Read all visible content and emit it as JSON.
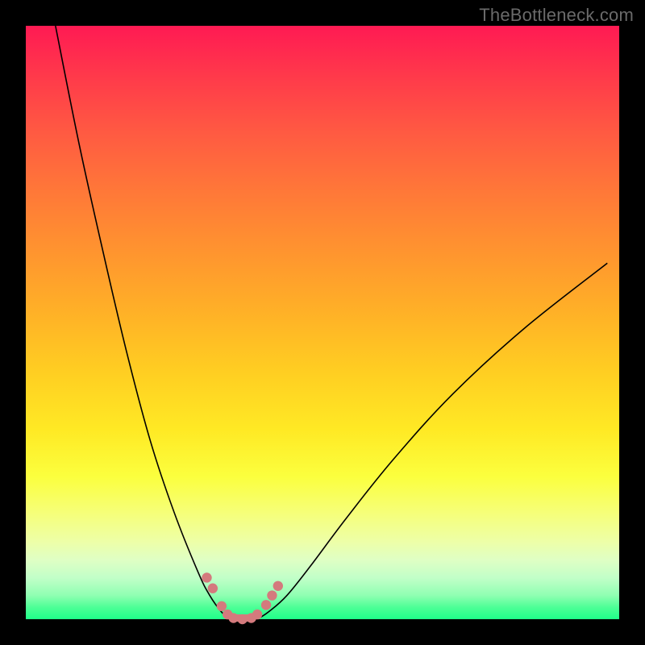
{
  "watermark": "TheBottleneck.com",
  "colors": {
    "frame": "#000000",
    "curve": "#000000",
    "beads": "#d47a7d"
  },
  "chart_data": {
    "type": "line",
    "title": "",
    "xlabel": "",
    "ylabel": "",
    "xlim": [
      0,
      100
    ],
    "ylim": [
      0,
      100
    ],
    "grid": false,
    "legend": false,
    "series": [
      {
        "name": "left-curve",
        "x": [
          5,
          9,
          13,
          17,
          21,
          25,
          29,
          31,
          33,
          34.5
        ],
        "y": [
          100,
          80,
          62,
          45,
          30,
          18,
          8,
          4,
          1.2,
          0
        ]
      },
      {
        "name": "right-curve",
        "x": [
          39,
          41,
          44,
          48,
          54,
          62,
          72,
          84,
          98
        ],
        "y": [
          0,
          1.3,
          4,
          9,
          17,
          27,
          38,
          49,
          60
        ]
      },
      {
        "name": "valley-floor",
        "x": [
          34.5,
          35.5,
          37,
          38,
          39
        ],
        "y": [
          0,
          0,
          0,
          0,
          0
        ]
      }
    ],
    "markers": {
      "name": "beads",
      "color": "#d47a7d",
      "points": [
        {
          "x": 30.5,
          "y": 7.0
        },
        {
          "x": 31.5,
          "y": 5.2
        },
        {
          "x": 33.0,
          "y": 2.2
        },
        {
          "x": 34.0,
          "y": 0.8
        },
        {
          "x": 35.0,
          "y": 0.2
        },
        {
          "x": 36.5,
          "y": 0.0
        },
        {
          "x": 38.0,
          "y": 0.2
        },
        {
          "x": 39.0,
          "y": 0.8
        },
        {
          "x": 40.5,
          "y": 2.4
        },
        {
          "x": 41.5,
          "y": 4.0
        },
        {
          "x": 42.5,
          "y": 5.6
        }
      ]
    }
  }
}
